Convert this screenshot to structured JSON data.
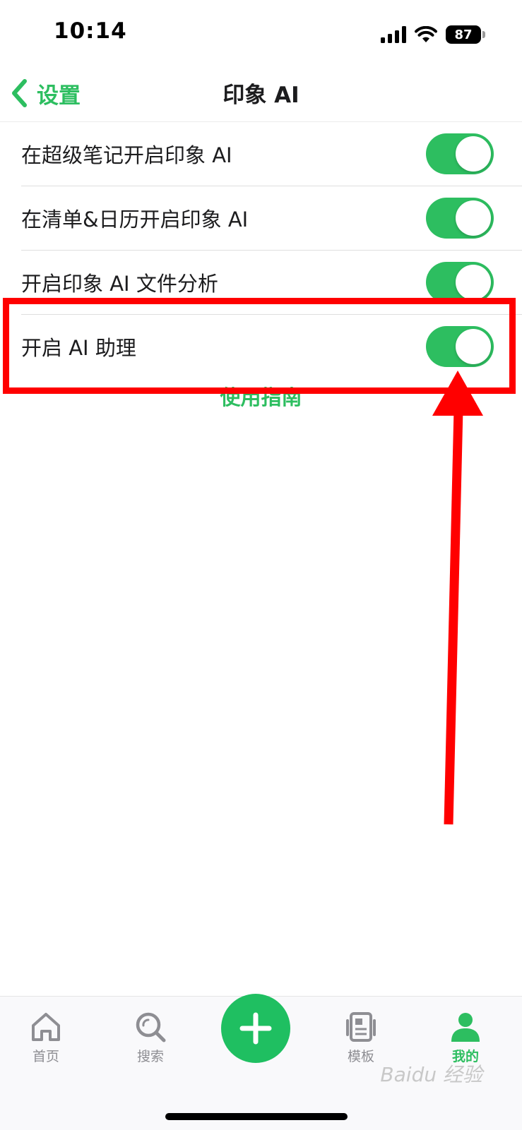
{
  "status_bar": {
    "time": "10:14",
    "battery": "87"
  },
  "nav": {
    "back_label": "设置",
    "title": "印象 AI"
  },
  "settings": [
    {
      "label": "在超级笔记开启印象 AI",
      "enabled": true
    },
    {
      "label": "在清单&日历开启印象 AI",
      "enabled": true
    },
    {
      "label": "开启印象 AI 文件分析",
      "enabled": true
    },
    {
      "label": "开启 AI 助理",
      "enabled": true
    }
  ],
  "guide_link": "使用指南",
  "tab_bar": {
    "items": [
      {
        "label": "首页",
        "icon": "home-icon"
      },
      {
        "label": "搜索",
        "icon": "search-icon"
      },
      {
        "label": "模板",
        "icon": "template-icon"
      },
      {
        "label": "我的",
        "icon": "person-icon"
      }
    ],
    "active": "我的"
  },
  "watermark": "Baidu 经验",
  "colors": {
    "accent": "#2dbe60",
    "annotation": "#ff0000",
    "inactive": "#8e8e93"
  }
}
